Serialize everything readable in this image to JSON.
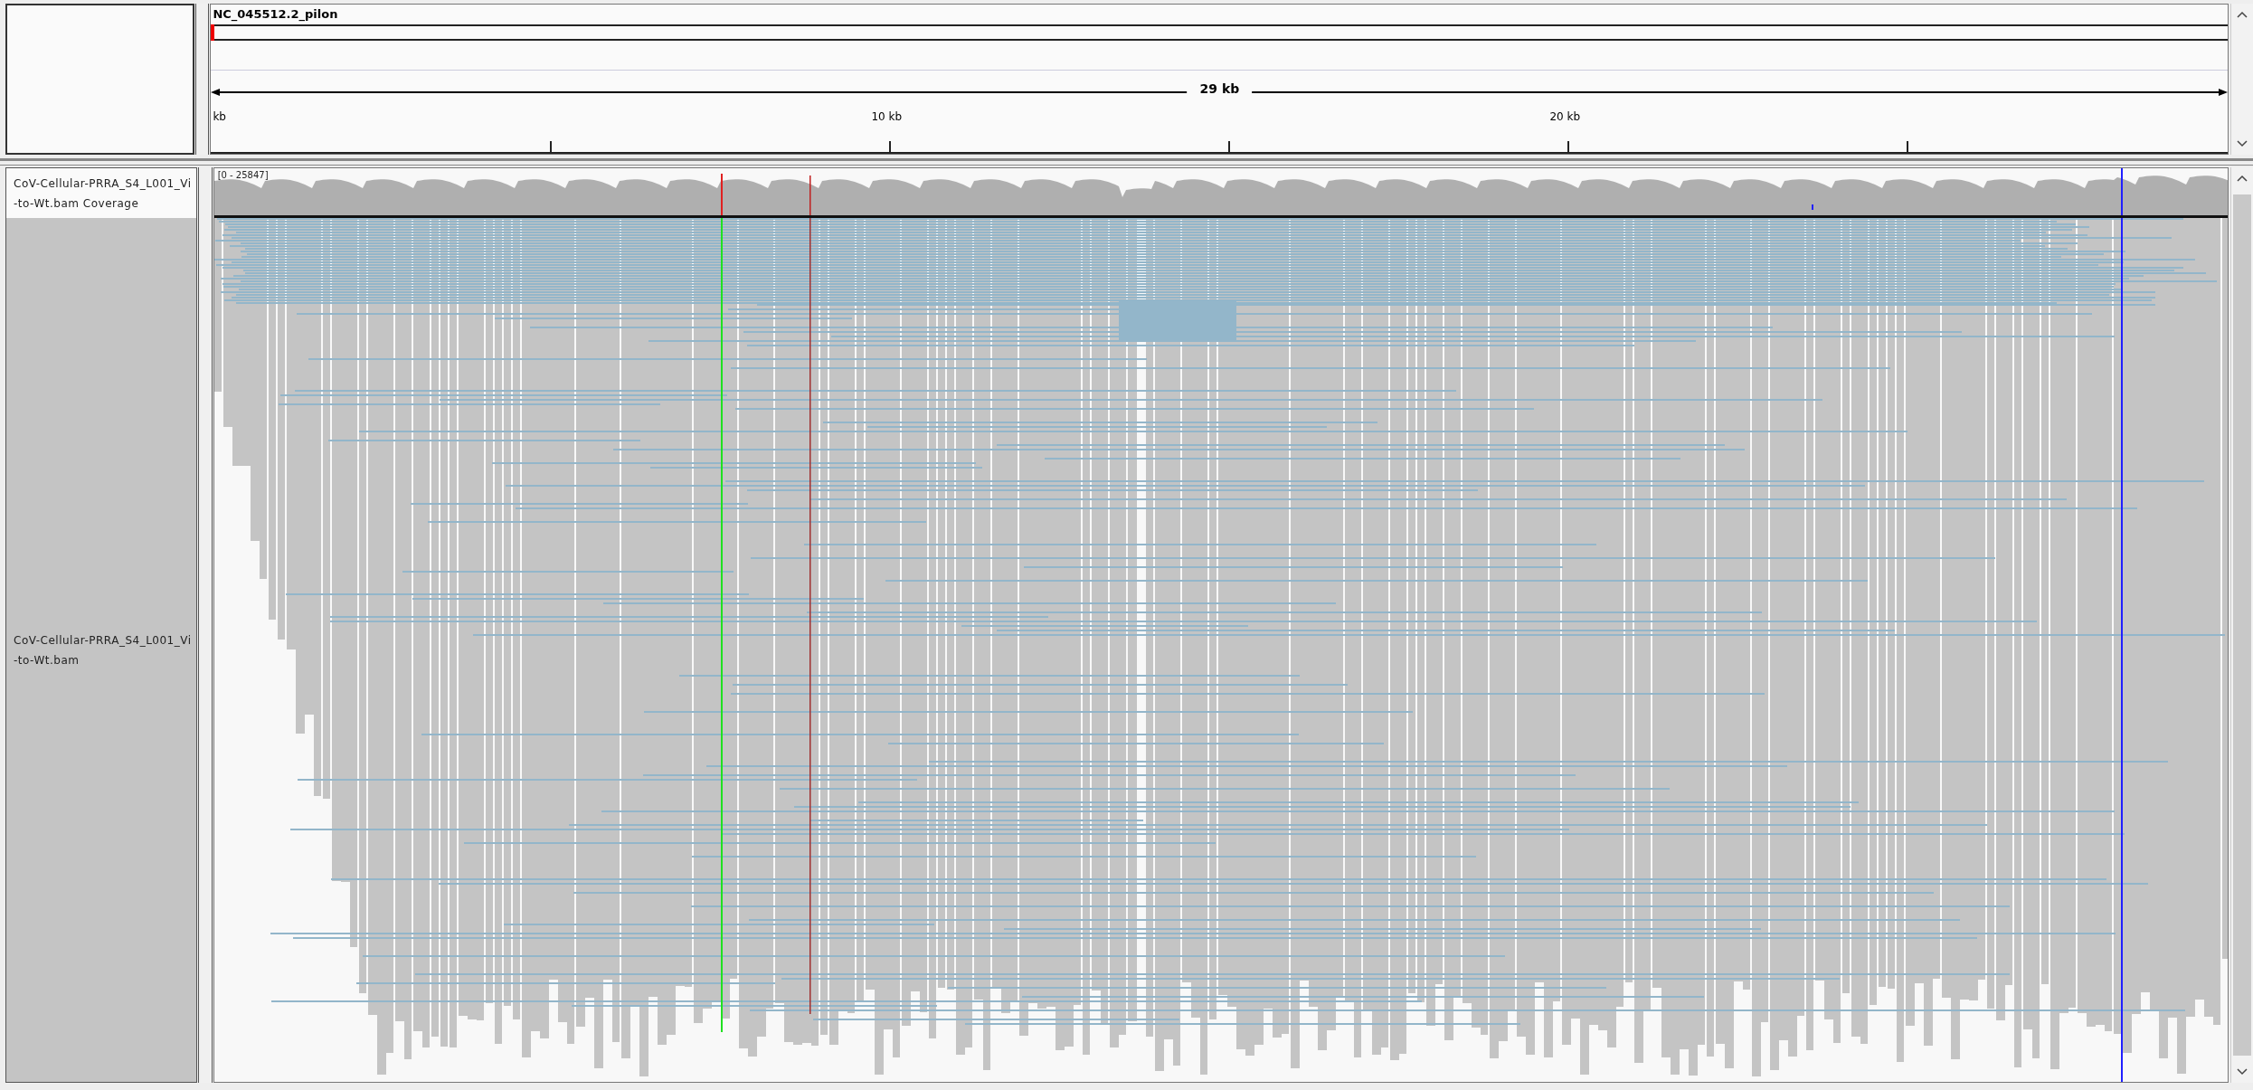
{
  "header": {
    "sequence_name": "NC_045512.2_pilon",
    "span_label": "29 kb",
    "ruler_labels": [
      "kb",
      "10 kb",
      "20 kb"
    ]
  },
  "tracks": [
    {
      "kind": "coverage",
      "name_lines": [
        "CoV-Cellular-PRRA_S4_L001_Vi",
        "-to-Wt.bam Coverage"
      ],
      "range": "[0 - 25847]"
    },
    {
      "kind": "alignment",
      "name_lines": [
        "CoV-Cellular-PRRA_S4_L001_Vi",
        "-to-Wt.bam"
      ]
    }
  ]
}
